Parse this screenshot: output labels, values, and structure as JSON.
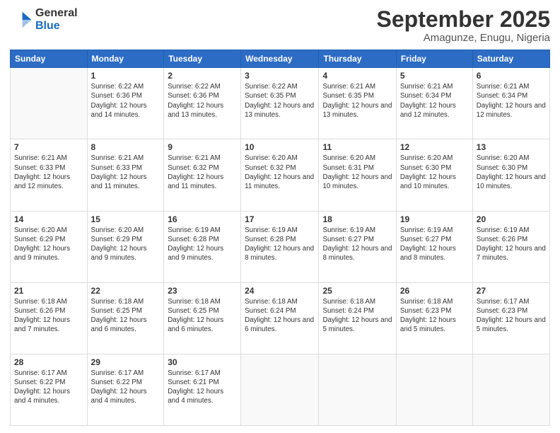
{
  "logo": {
    "general": "General",
    "blue": "Blue"
  },
  "header": {
    "month": "September 2025",
    "location": "Amagunze, Enugu, Nigeria"
  },
  "days": [
    "Sunday",
    "Monday",
    "Tuesday",
    "Wednesday",
    "Thursday",
    "Friday",
    "Saturday"
  ],
  "weeks": [
    [
      {
        "day": "",
        "sunrise": "",
        "sunset": "",
        "daylight": ""
      },
      {
        "day": "1",
        "sunrise": "6:22 AM",
        "sunset": "6:36 PM",
        "daylight": "12 hours and 14 minutes."
      },
      {
        "day": "2",
        "sunrise": "6:22 AM",
        "sunset": "6:36 PM",
        "daylight": "12 hours and 13 minutes."
      },
      {
        "day": "3",
        "sunrise": "6:22 AM",
        "sunset": "6:35 PM",
        "daylight": "12 hours and 13 minutes."
      },
      {
        "day": "4",
        "sunrise": "6:21 AM",
        "sunset": "6:35 PM",
        "daylight": "12 hours and 13 minutes."
      },
      {
        "day": "5",
        "sunrise": "6:21 AM",
        "sunset": "6:34 PM",
        "daylight": "12 hours and 12 minutes."
      },
      {
        "day": "6",
        "sunrise": "6:21 AM",
        "sunset": "6:34 PM",
        "daylight": "12 hours and 12 minutes."
      }
    ],
    [
      {
        "day": "7",
        "sunrise": "6:21 AM",
        "sunset": "6:33 PM",
        "daylight": "12 hours and 12 minutes."
      },
      {
        "day": "8",
        "sunrise": "6:21 AM",
        "sunset": "6:33 PM",
        "daylight": "12 hours and 11 minutes."
      },
      {
        "day": "9",
        "sunrise": "6:21 AM",
        "sunset": "6:32 PM",
        "daylight": "12 hours and 11 minutes."
      },
      {
        "day": "10",
        "sunrise": "6:20 AM",
        "sunset": "6:32 PM",
        "daylight": "12 hours and 11 minutes."
      },
      {
        "day": "11",
        "sunrise": "6:20 AM",
        "sunset": "6:31 PM",
        "daylight": "12 hours and 10 minutes."
      },
      {
        "day": "12",
        "sunrise": "6:20 AM",
        "sunset": "6:30 PM",
        "daylight": "12 hours and 10 minutes."
      },
      {
        "day": "13",
        "sunrise": "6:20 AM",
        "sunset": "6:30 PM",
        "daylight": "12 hours and 10 minutes."
      }
    ],
    [
      {
        "day": "14",
        "sunrise": "6:20 AM",
        "sunset": "6:29 PM",
        "daylight": "12 hours and 9 minutes."
      },
      {
        "day": "15",
        "sunrise": "6:20 AM",
        "sunset": "6:29 PM",
        "daylight": "12 hours and 9 minutes."
      },
      {
        "day": "16",
        "sunrise": "6:19 AM",
        "sunset": "6:28 PM",
        "daylight": "12 hours and 9 minutes."
      },
      {
        "day": "17",
        "sunrise": "6:19 AM",
        "sunset": "6:28 PM",
        "daylight": "12 hours and 8 minutes."
      },
      {
        "day": "18",
        "sunrise": "6:19 AM",
        "sunset": "6:27 PM",
        "daylight": "12 hours and 8 minutes."
      },
      {
        "day": "19",
        "sunrise": "6:19 AM",
        "sunset": "6:27 PM",
        "daylight": "12 hours and 8 minutes."
      },
      {
        "day": "20",
        "sunrise": "6:19 AM",
        "sunset": "6:26 PM",
        "daylight": "12 hours and 7 minutes."
      }
    ],
    [
      {
        "day": "21",
        "sunrise": "6:18 AM",
        "sunset": "6:26 PM",
        "daylight": "12 hours and 7 minutes."
      },
      {
        "day": "22",
        "sunrise": "6:18 AM",
        "sunset": "6:25 PM",
        "daylight": "12 hours and 6 minutes."
      },
      {
        "day": "23",
        "sunrise": "6:18 AM",
        "sunset": "6:25 PM",
        "daylight": "12 hours and 6 minutes."
      },
      {
        "day": "24",
        "sunrise": "6:18 AM",
        "sunset": "6:24 PM",
        "daylight": "12 hours and 6 minutes."
      },
      {
        "day": "25",
        "sunrise": "6:18 AM",
        "sunset": "6:24 PM",
        "daylight": "12 hours and 5 minutes."
      },
      {
        "day": "26",
        "sunrise": "6:18 AM",
        "sunset": "6:23 PM",
        "daylight": "12 hours and 5 minutes."
      },
      {
        "day": "27",
        "sunrise": "6:17 AM",
        "sunset": "6:23 PM",
        "daylight": "12 hours and 5 minutes."
      }
    ],
    [
      {
        "day": "28",
        "sunrise": "6:17 AM",
        "sunset": "6:22 PM",
        "daylight": "12 hours and 4 minutes."
      },
      {
        "day": "29",
        "sunrise": "6:17 AM",
        "sunset": "6:22 PM",
        "daylight": "12 hours and 4 minutes."
      },
      {
        "day": "30",
        "sunrise": "6:17 AM",
        "sunset": "6:21 PM",
        "daylight": "12 hours and 4 minutes."
      },
      {
        "day": "",
        "sunrise": "",
        "sunset": "",
        "daylight": ""
      },
      {
        "day": "",
        "sunrise": "",
        "sunset": "",
        "daylight": ""
      },
      {
        "day": "",
        "sunrise": "",
        "sunset": "",
        "daylight": ""
      },
      {
        "day": "",
        "sunrise": "",
        "sunset": "",
        "daylight": ""
      }
    ]
  ],
  "labels": {
    "sunrise_prefix": "Sunrise: ",
    "sunset_prefix": "Sunset: ",
    "daylight_prefix": "Daylight: "
  }
}
